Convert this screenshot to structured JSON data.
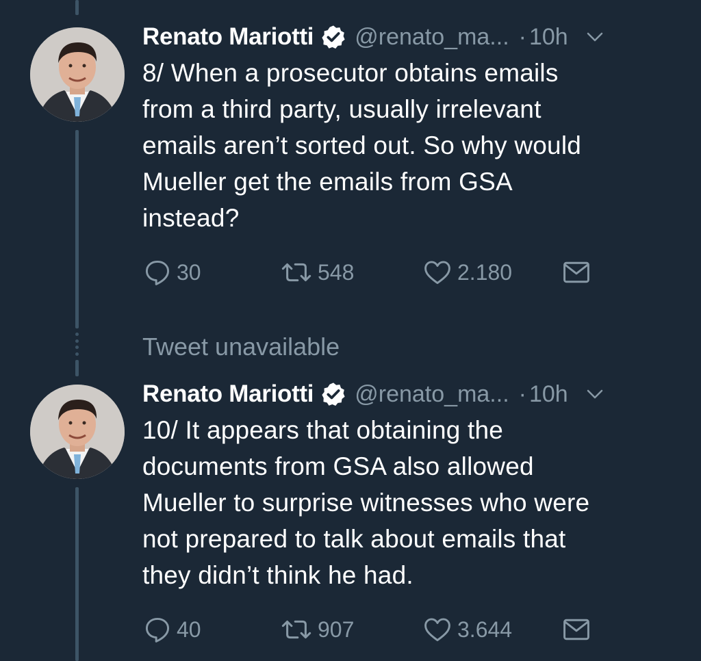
{
  "tweets": [
    {
      "author_name": "Renato Mariotti",
      "handle": "@renato_ma...",
      "separator": "·",
      "time": "10h",
      "text_lines": [
        "8/ When a prosecutor obtains emails",
        "from a third party, usually irrelevant",
        "emails aren’t sorted out. So why would",
        "Mueller get the emails from GSA",
        "instead?"
      ],
      "replies": "30",
      "retweets": "548",
      "likes": "2.180"
    },
    {
      "author_name": "Renato Mariotti",
      "handle": "@renato_ma...",
      "separator": "·",
      "time": "10h",
      "text_lines": [
        "10/ It appears that obtaining the",
        "documents from GSA also allowed",
        "Mueller to surprise witnesses who were",
        "not prepared to talk about emails that",
        "they didn’t think he had."
      ],
      "replies": "40",
      "retweets": "907",
      "likes": "3.644"
    }
  ],
  "unavailable_text": "Tweet unavailable",
  "colors": {
    "background": "#1b2836",
    "text": "#ffffff",
    "muted": "#8899a6",
    "thread_line": "#3d5466"
  },
  "icons": {
    "verified": "verified-badge-icon",
    "menu": "chevron-down-icon",
    "reply": "reply-bubble-icon",
    "retweet": "retweet-icon",
    "like": "heart-icon",
    "dm": "envelope-icon"
  }
}
